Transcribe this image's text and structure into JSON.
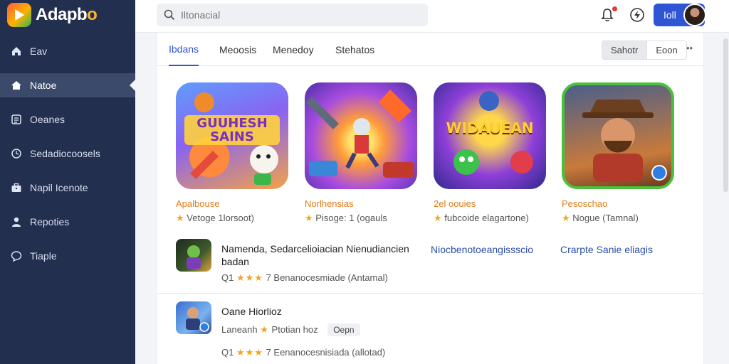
{
  "app": {
    "brand_name_main": "Adapb",
    "brand_name_accent": "o"
  },
  "search": {
    "value": "",
    "placeholder": "Iltonacial"
  },
  "sidebar": {
    "items": [
      {
        "label": "Eav",
        "icon": "home-icon"
      },
      {
        "label": "Natoe",
        "icon": "house-icon"
      },
      {
        "label": "Oeanes",
        "icon": "news-icon"
      },
      {
        "label": "Sedadiocoosels",
        "icon": "clock-icon"
      },
      {
        "label": "Napil Icenote",
        "icon": "toolbox-icon"
      },
      {
        "label": "Repoties",
        "icon": "user-icon"
      },
      {
        "label": "Tiaple",
        "icon": "chat-icon"
      }
    ]
  },
  "topbar": {
    "user_button_label": "Ioll"
  },
  "tabs": [
    {
      "label": "Ibdans"
    },
    {
      "label": "Meoosis"
    },
    {
      "label": "Menedoy"
    },
    {
      "label": "Stehatos"
    }
  ],
  "segments": [
    {
      "label": "Sahotr"
    },
    {
      "label": "Eoon"
    }
  ],
  "tab_more": "••",
  "cards": [
    {
      "art_text": "GUUHESH SAINS",
      "title": "Apalbouse",
      "meta": "Vetoge 1lorsoot)",
      "accent": "#e07b1a"
    },
    {
      "art_text": "",
      "title": "Norlhensias",
      "meta": "Pisoge: 1 (ogauls",
      "accent": "#e07b1a"
    },
    {
      "art_text": "WIDAUEAN",
      "title": "2el oouies",
      "meta": "fubcoide elagartone)",
      "accent": "#e07b1a"
    },
    {
      "art_text": "",
      "title": "Pesoschao",
      "meta": "Nogue (Tamnal)",
      "accent": "#e07b1a"
    }
  ],
  "list": [
    {
      "title": "Namenda, Sedarcelioiacian Nienudiancien",
      "title_line2": "badan",
      "rating": "Q1",
      "stars": "★★★",
      "meta": "7 Benanocesmiade (Antamal)",
      "links": [
        "Niocbenotoeangissscio",
        "Crarpte Sanie eliagis"
      ]
    },
    {
      "title": "Oane Hiorlioz",
      "sub_label": "Laneanh",
      "sub_label2": "Ptotian hoz",
      "chip": "Oepn",
      "rating": "Q1",
      "stars": "★★★",
      "meta": "7 Eenanocesnisiada (allotad)"
    }
  ]
}
